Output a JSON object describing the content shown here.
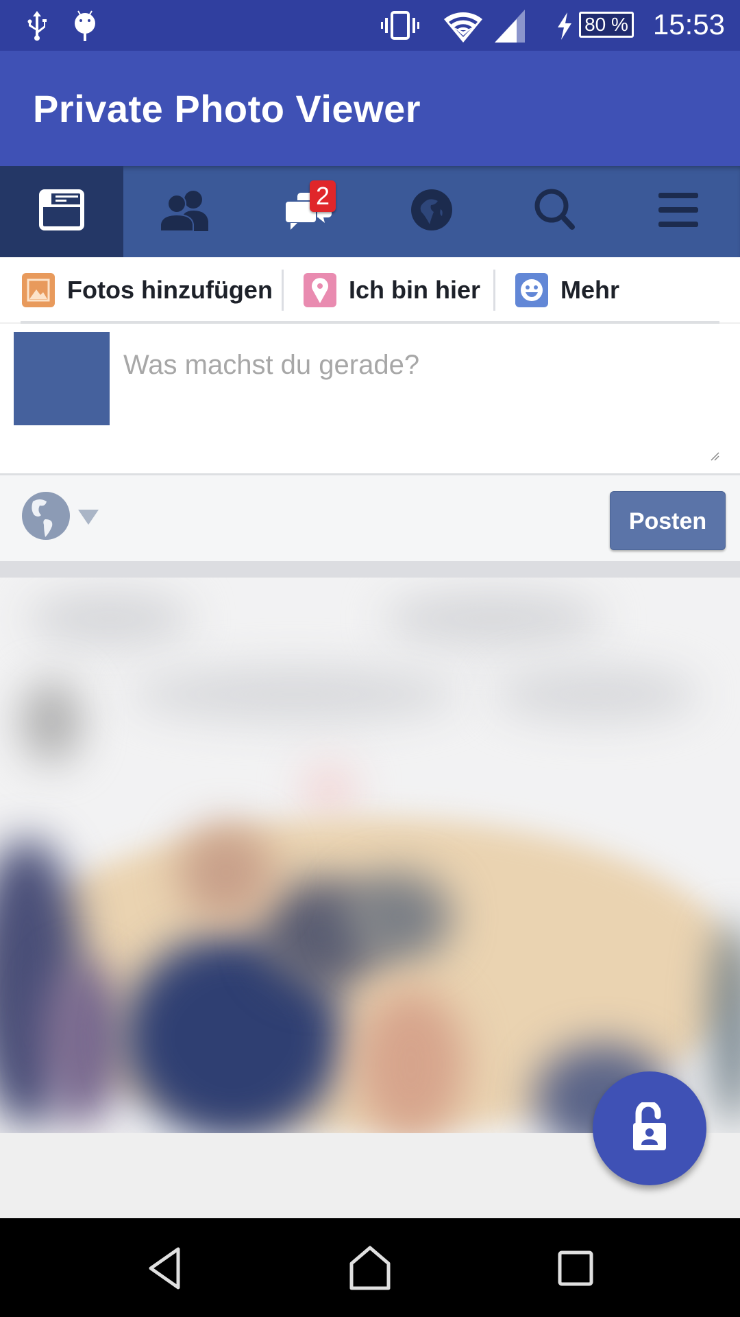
{
  "status_bar": {
    "left_icons": [
      "usb-icon",
      "android-debug-icon"
    ],
    "right_icons": [
      "vibrate-icon",
      "wifi-icon",
      "cell-signal-icon",
      "charging-icon"
    ],
    "battery_percent": "80 %",
    "time": "15:53"
  },
  "app_bar": {
    "title": "Private Photo Viewer"
  },
  "tabs": [
    {
      "name": "news-feed",
      "icon": "news-feed-icon",
      "active": true
    },
    {
      "name": "friends",
      "icon": "friends-icon",
      "active": false
    },
    {
      "name": "messages",
      "icon": "messages-icon",
      "active": false,
      "badge": "2"
    },
    {
      "name": "notifications",
      "icon": "globe-icon",
      "active": false
    },
    {
      "name": "search",
      "icon": "search-icon",
      "active": false
    },
    {
      "name": "menu",
      "icon": "menu-icon",
      "active": false
    }
  ],
  "composer": {
    "actions": [
      {
        "label": "Fotos hinzufügen",
        "icon": "photo-icon",
        "color": "#e89a5c"
      },
      {
        "label": "Ich bin hier",
        "icon": "location-pin-icon",
        "color": "#e98bb0"
      },
      {
        "label": "Mehr",
        "icon": "smiley-icon",
        "color": "#6287d6"
      }
    ],
    "placeholder": "Was machst du gerade?",
    "audience_icon": "globe-public-icon",
    "post_label": "Posten"
  },
  "fab": {
    "icon": "unlock-person-icon"
  },
  "nav_bar": {
    "buttons": [
      "back",
      "home",
      "recents"
    ]
  },
  "colors": {
    "status_bar": "#303f9f",
    "app_bar": "#3f51b5",
    "tab_bar": "#3b5998",
    "tab_active": "#243766",
    "badge": "#e0262a",
    "post_button": "#5b74a8",
    "avatar": "#45619d"
  }
}
